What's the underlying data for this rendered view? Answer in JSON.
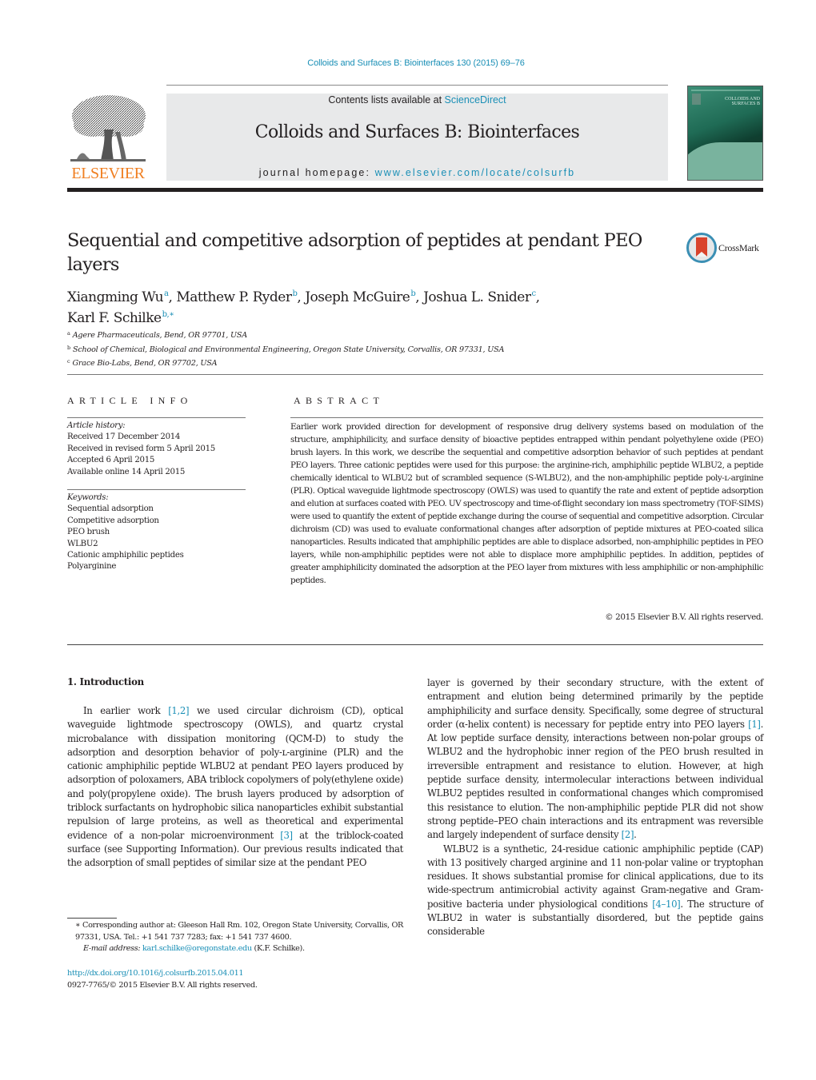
{
  "header": {
    "journal_citation": "Colloids and Surfaces B: Biointerfaces 130 (2015) 69–76",
    "publisher_logo_text": "ELSEVIER",
    "contents_prefix": "Contents lists available at ",
    "contents_link": "ScienceDirect",
    "journal_title": "Colloids and Surfaces B: Biointerfaces",
    "homepage_prefix": "journal homepage: ",
    "homepage_link": "www.elsevier.com/locate/colsurfb",
    "cover_title_line1": "COLLOIDS AND",
    "cover_title_line2": "SURFACES B"
  },
  "article": {
    "title": "Sequential and competitive adsorption of peptides at pendant PEO layers",
    "crossmark_label": "CrossMark",
    "authors": [
      {
        "name": "Xiangming Wu",
        "affil": "a",
        "sep": ", "
      },
      {
        "name": "Matthew P. Ryder",
        "affil": "b",
        "sep": ", "
      },
      {
        "name": "Joseph McGuire",
        "affil": "b",
        "sep": ", "
      },
      {
        "name": "Joshua L. Snider",
        "affil": "c",
        "sep": ","
      },
      {
        "name": "Karl F. Schilke",
        "affil": "b,∗",
        "sep": ""
      }
    ],
    "affiliations": [
      {
        "key": "a",
        "text": "Agere Pharmaceuticals, Bend, OR 97701, USA"
      },
      {
        "key": "b",
        "text": "School of Chemical, Biological and Environmental Engineering, Oregon State University, Corvallis, OR 97331, USA"
      },
      {
        "key": "c",
        "text": "Grace Bio-Labs, Bend, OR 97702, USA"
      }
    ]
  },
  "article_info": {
    "heading": "ARTICLE INFO",
    "history_label": "Article history:",
    "history": [
      "Received 17 December 2014",
      "Received in revised form 5 April 2015",
      "Accepted 6 April 2015",
      "Available online 14 April 2015"
    ],
    "keywords_label": "Keywords:",
    "keywords": [
      "Sequential adsorption",
      "Competitive adsorption",
      "PEO brush",
      "WLBU2",
      "Cationic amphiphilic peptides",
      "Polyarginine"
    ]
  },
  "abstract": {
    "heading": "ABSTRACT",
    "text": "Earlier work provided direction for development of responsive drug delivery systems based on mod­ulation of the structure, amphiphilicity, and surface density of bioactive peptides entrapped within pendant polyethylene oxide (PEO) brush layers. In this work, we describe the sequential and competi­tive adsorption behavior of such peptides at pendant PEO layers. Three cationic peptides were used for this purpose: the arginine-rich, amphiphilic peptide WLBU2, a peptide chemically identical to WLBU2 but of scrambled sequence (S-WLBU2), and the non-amphiphilic peptide poly-ʟ-arginine (PLR). Optical waveguide lightmode spectroscopy (OWLS) was used to quantify the rate and extent of peptide adsorp­tion and elution at surfaces coated with PEO. UV spectroscopy and time-of-flight secondary ion mass spectrometry (TOF-SIMS) were used to quantify the extent of peptide exchange during the course of sequential and competitive adsorption. Circular dichroism (CD) was used to evaluate conformational changes after adsorption of peptide mixtures at PEO-coated silica nanoparticles. Results indicated that amphiphilic peptides are able to displace adsorbed, non-amphiphilic peptides in PEO layers, while non-amphiphilic peptides were not able to displace more amphiphilic peptides. In addition, peptides of greater amphiphilicity dominated the adsorption at the PEO layer from mixtures with less amphiphilic or non-amphiphilic peptides.",
    "copyright": "© 2015 Elsevier B.V. All rights reserved."
  },
  "body": {
    "section_heading": "1.  Introduction",
    "left_paragraph": {
      "before_ref1": "In earlier work ",
      "ref1": "[1,2]",
      "after_ref1": " we used circular dichroism (CD), opti­cal waveguide lightmode spectroscopy (OWLS), and quartz crystal microbalance with dissipation monitoring (QCM-D) to study the adsorption and desorption behavior of poly-ʟ-arginine (PLR) and the cationic amphiphilic peptide WLBU2 at pendant PEO layers produced by adsorption of poloxamers, ABA triblock copolymers of poly(ethylene oxide) and poly(propylene oxide). The brush lay­ers produced by adsorption of triblock surfactants on hydrophobic silica nanoparticles exhibit substantial repulsion of large proteins, as well as theoretical and experimental evidence of a non-polar microenvironment ",
      "ref2": "[3]",
      "after_ref2": " at the triblock-coated surface (see Sup­porting Information). Our previous results indicated that the adsorption of small peptides of similar size at the pendant PEO"
    },
    "right_paragraph_1": {
      "before_ref1": "layer is governed by their secondary structure, with the extent of entrapment and elution being determined primarily by the pep­tide amphiphilicity and surface density. Specifically, some degree of structural order (α-helix content) is necessary for peptide entry into PEO layers ",
      "ref1": "[1]",
      "after_ref1": ". At low peptide surface density, interactions between non-polar groups of WLBU2 and the hydrophobic inner region of the PEO brush resulted in irreversible entrapment and resistance to elution. However, at high peptide surface density, intermolecular interactions between individual WLBU2 peptides resulted in con­formational changes which compromised this resistance to elution. The non-amphiphilic peptide PLR did not show strong peptide–PEO chain interactions and its entrapment was reversible and largely independent of surface density ",
      "ref2": "[2]",
      "after_ref2": "."
    },
    "right_paragraph_2": {
      "before_ref1": "WLBU2 is a synthetic, 24-residue cationic amphiphilic peptide (CAP) with 13 positively charged arginine and 11 non-polar valine or tryptophan residues. It shows substantial promise for clinical applications, due to its wide-spectrum antimicrobial activity against Gram-negative and Gram-positive bacteria under physiological conditions ",
      "ref1": "[4–10]",
      "after_ref1": ". The structure of WLBU2 in water is substantially disordered, but the peptide gains considerable"
    }
  },
  "footnote": {
    "corresponding": "∗  Corresponding author at: Gleeson Hall Rm. 102, Oregon State University, Cor­vallis, OR 97331, USA. Tel.: +1 541 737 7283; fax: +1 541 737 4600.",
    "email_label": "E-mail address:",
    "email": "karl.schilke@oregonstate.edu",
    "email_suffix": " (K.F. Schilke).",
    "doi": "http://dx.doi.org/10.1016/j.colsurfb.2015.04.011",
    "issn_line": "0927-7765/© 2015 Elsevier B.V. All rights reserved."
  },
  "colors": {
    "link": "#1a8fb6",
    "elsevier_orange": "#f07f21",
    "band_grey": "#e8e9ea",
    "text": "#231f20"
  }
}
